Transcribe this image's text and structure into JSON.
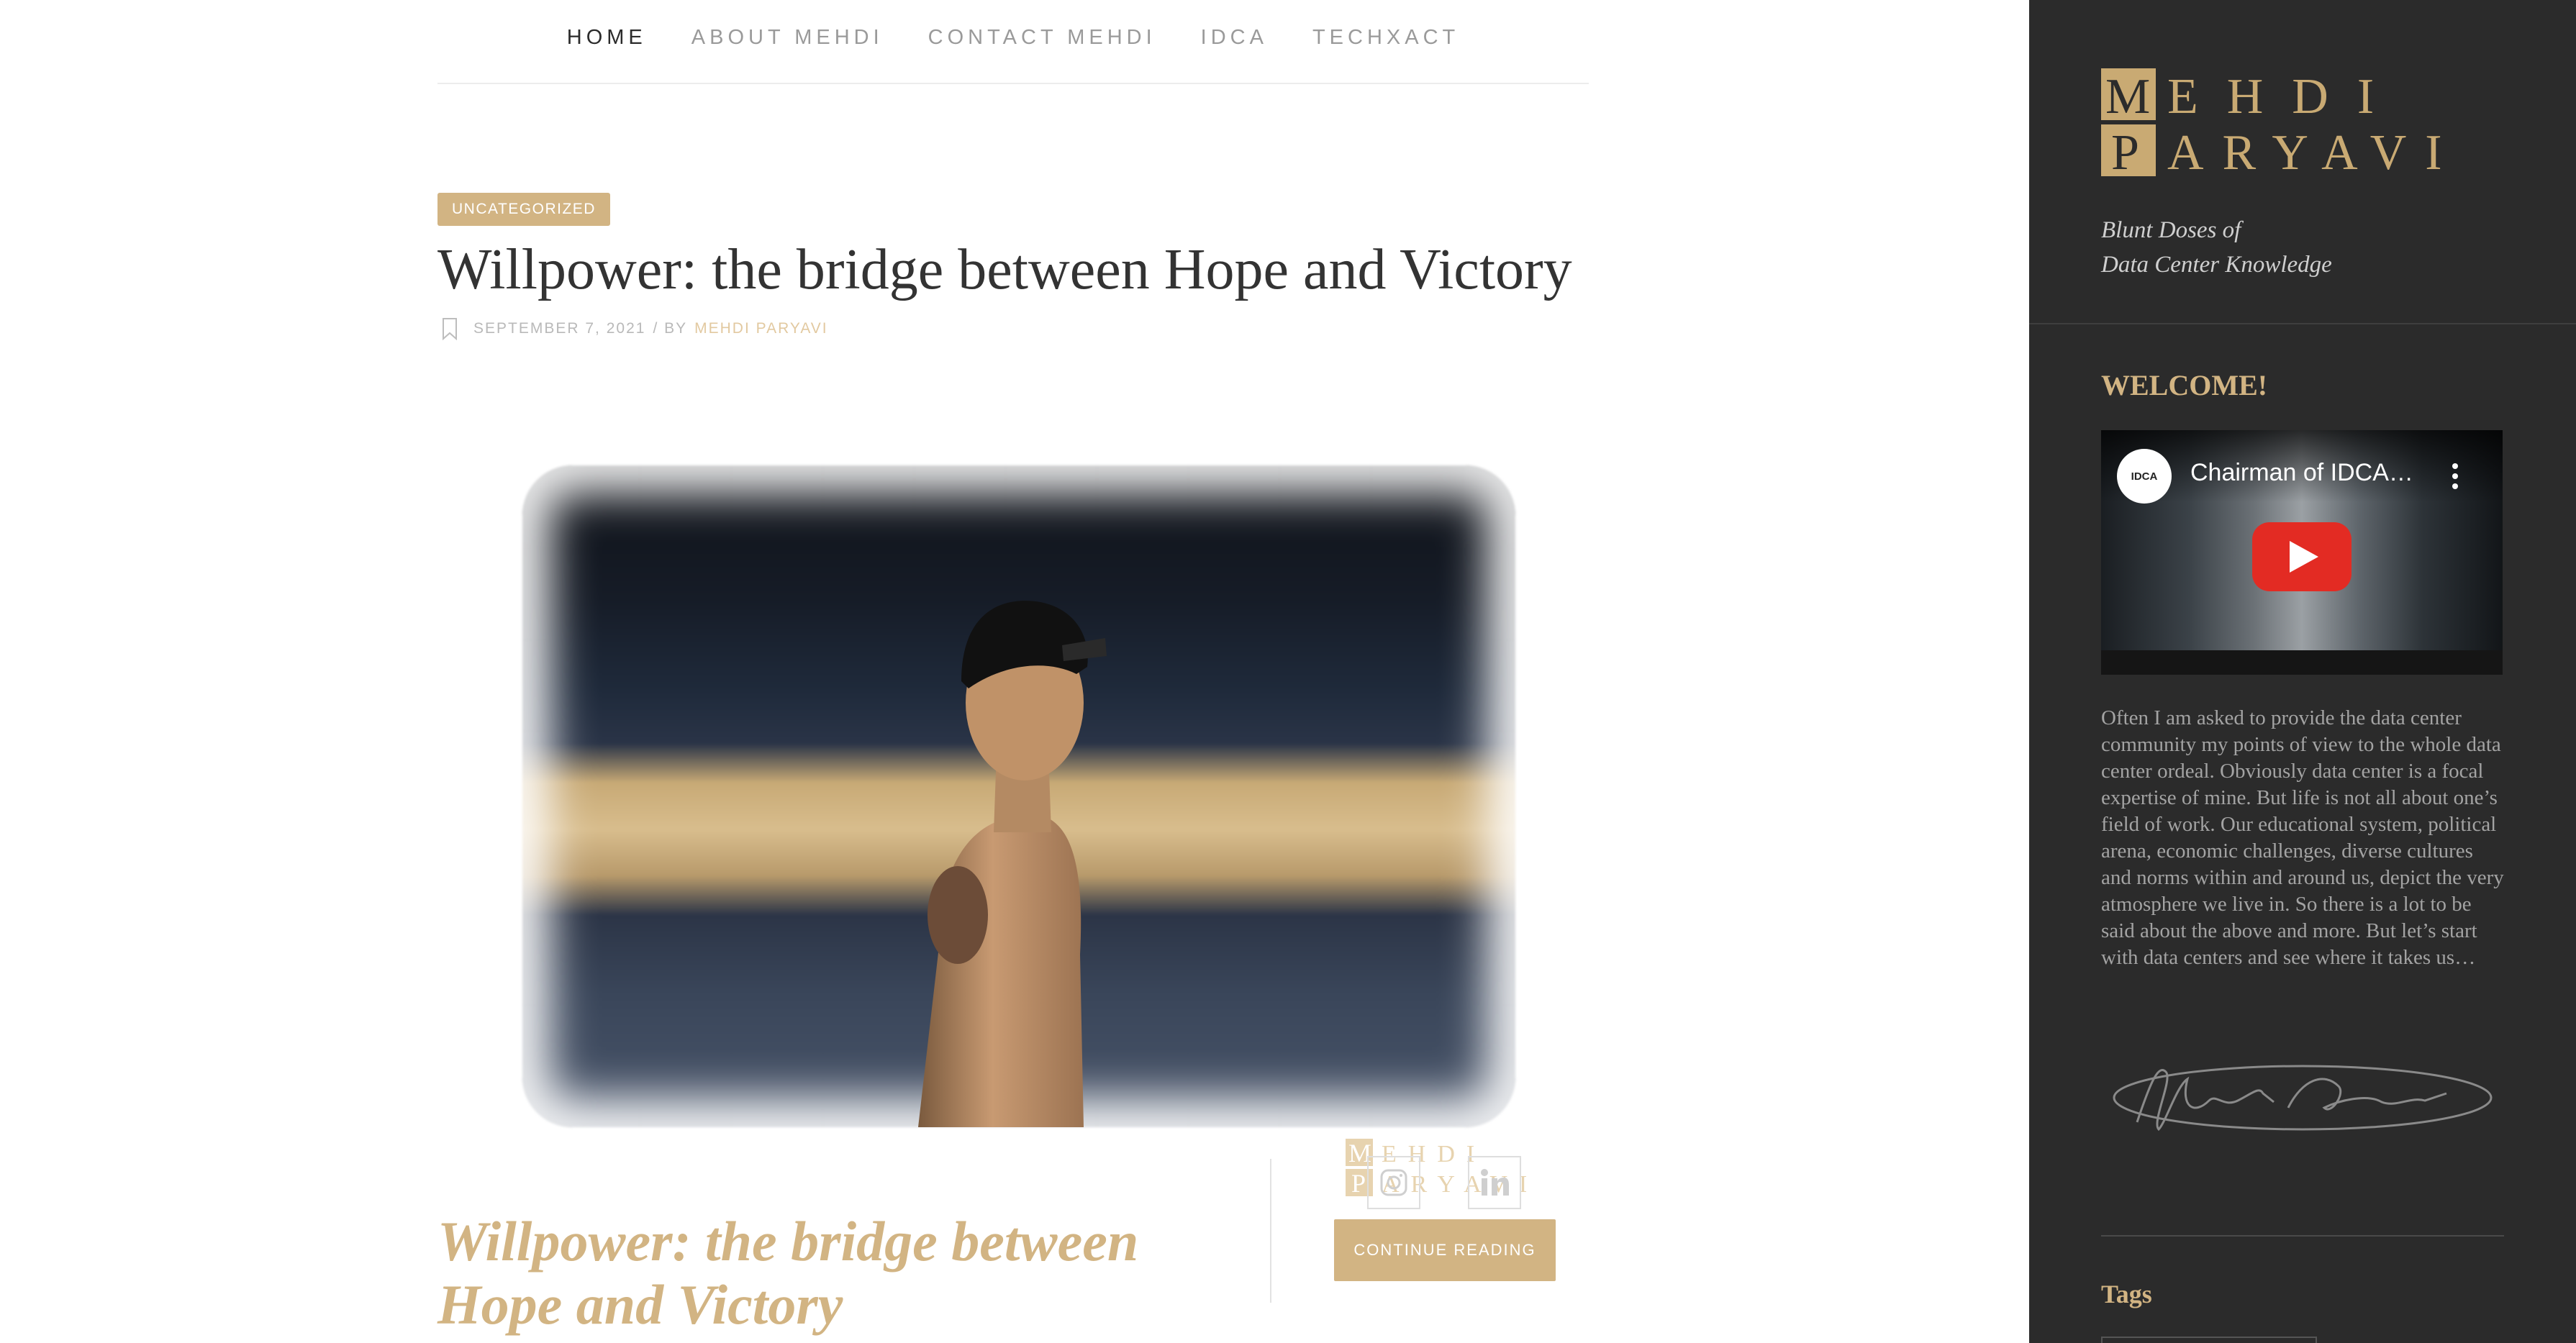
{
  "nav": {
    "items": [
      {
        "label": "HOME",
        "active": true
      },
      {
        "label": "ABOUT MEHDI",
        "active": false
      },
      {
        "label": "CONTACT MEHDI",
        "active": false
      },
      {
        "label": "IDCA",
        "active": false
      },
      {
        "label": "TECHXACT",
        "active": false
      }
    ]
  },
  "post": {
    "category": "UNCATEGORIZED",
    "title": "Willpower: the bridge between Hope and Victory",
    "date": "SEPTEMBER 7, 2021",
    "by": "/ BY",
    "author": "MEHDI PARYAVI",
    "excerpt_title": "Willpower: the bridge between Hope and Victory",
    "continue_label": "CONTINUE READING",
    "watermark": "MEHDI PARYAVI"
  },
  "social": [
    {
      "icon": "instagram-icon"
    },
    {
      "icon": "linkedin-icon"
    }
  ],
  "sidebar": {
    "logo_text": "MEHDI PARYAVI",
    "tagline_line1": "Blunt Doses of",
    "tagline_line2": "Data Center Knowledge",
    "welcome_heading": "WELCOME!",
    "video": {
      "title": "Chairman of IDCA…",
      "channel": "IDCA"
    },
    "intro": "Often I am asked to provide the data center community my points of view to the whole data center ordeal. Obviously data center is a focal expertise of mine. But life is not all about one’s field of work. Our educational system, political arena, economic challenges, diverse cultures and norms within and around us, depict the very atmosphere we live in. So there is a lot to be said about the above and more. But let’s start with data centers and see where it takes us…",
    "tags_heading": "Tags"
  },
  "colors": {
    "accent": "#d2b483",
    "sidebar_bg": "#2b2b2b",
    "logo_gold": "#c9aa73",
    "youtube_red": "#e32b23"
  }
}
